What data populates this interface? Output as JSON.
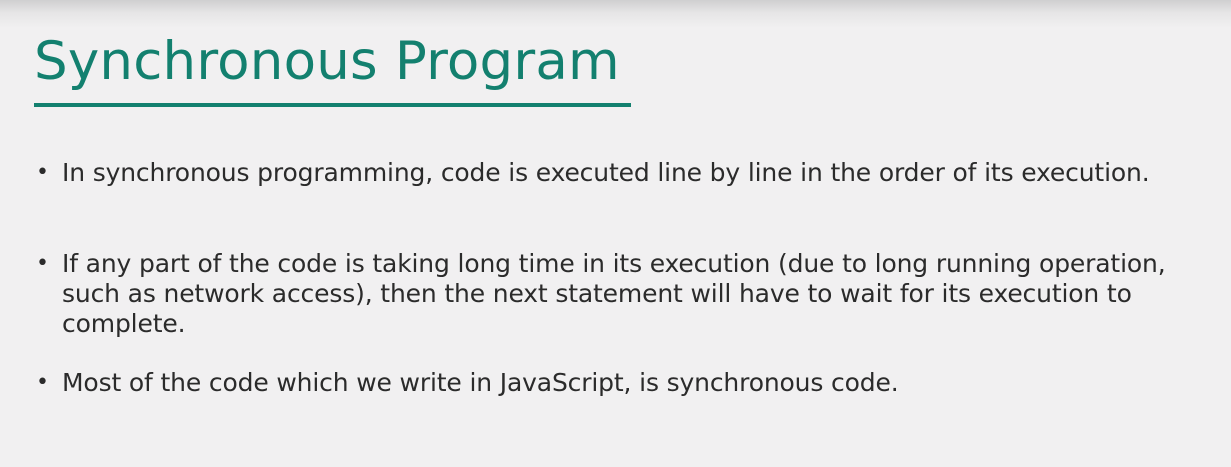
{
  "slide": {
    "title": "Synchronous Program",
    "bullets": [
      {
        "symbol": "•",
        "text": "In synchronous programming, code is executed line by line in the order of its execution."
      },
      {
        "symbol": "•",
        "text": "If any part of the code is taking long time in its execution (due to long running operation, such as network access), then the next statement will have to wait for its execution to complete."
      },
      {
        "symbol": "•",
        "text": "Most of the code which we write in JavaScript, is synchronous code."
      }
    ]
  },
  "colors": {
    "title": "#13806f",
    "text": "#2b2b2b",
    "background": "#f1f0f1"
  }
}
